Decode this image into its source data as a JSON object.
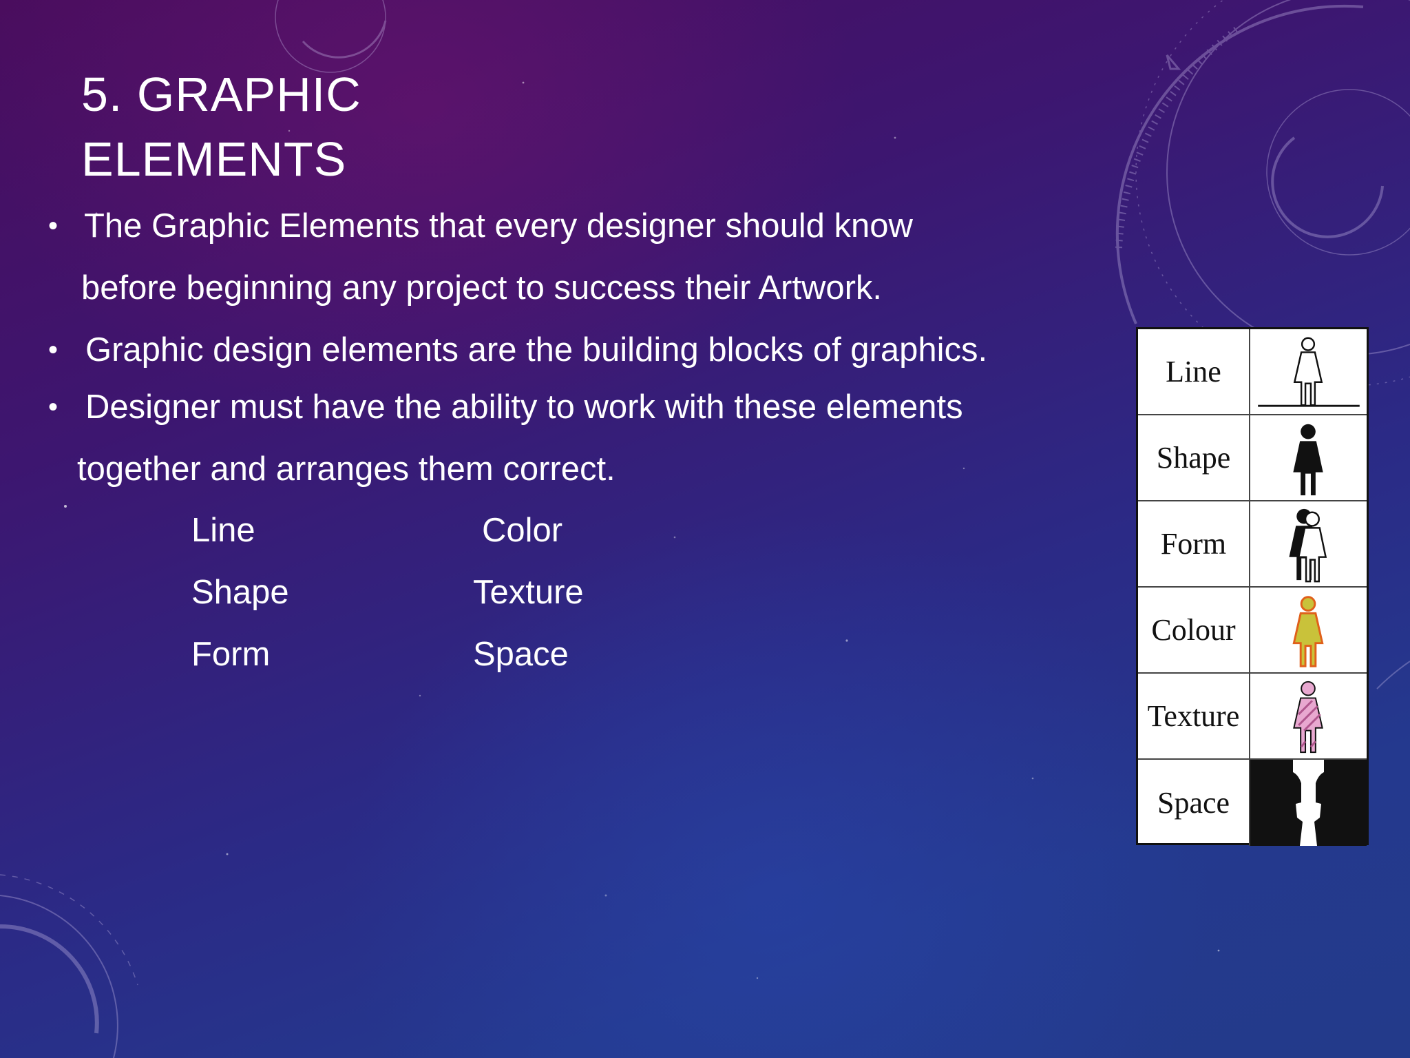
{
  "slide": {
    "title_line1": "5. GRAPHIC",
    "title_line2": "ELEMENTS",
    "bullets": [
      {
        "line1": "The Graphic Elements that every designer should know",
        "line2": "before beginning any project to success their Artwork."
      },
      {
        "line1": "Graphic design elements are the building blocks of graphics."
      },
      {
        "line1": "Designer must have the ability to work with these elements",
        "line2": "together and arranges them correct."
      }
    ],
    "bullet_glyph": "•",
    "elements_grid": {
      "left": [
        "Line",
        "Shape",
        "Form"
      ],
      "right": [
        "Color",
        "Texture",
        "Space"
      ]
    }
  },
  "figure": {
    "rows": [
      {
        "label": "Line",
        "icon": "outline-person-on-line-icon"
      },
      {
        "label": "Shape",
        "icon": "solid-person-silhouette-icon"
      },
      {
        "label": "Form",
        "icon": "overlapping-person-form-icon"
      },
      {
        "label": "Colour",
        "icon": "colored-person-icon"
      },
      {
        "label": "Texture",
        "icon": "textured-person-icon"
      },
      {
        "label": "Space",
        "icon": "negative-space-faces-icon"
      }
    ],
    "colors": {
      "colour_fill": "#c9c23a",
      "colour_outline": "#e0601a",
      "texture_fill": "#e8a8d0",
      "texture_stripe": "#b0568e"
    }
  }
}
